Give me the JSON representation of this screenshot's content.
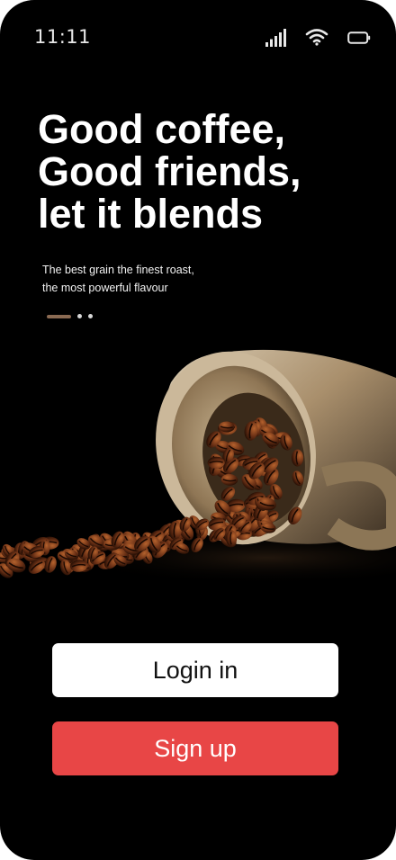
{
  "status_bar": {
    "time": "11:11",
    "icons": [
      "signal-icon",
      "wifi-icon",
      "battery-icon"
    ]
  },
  "hero": {
    "headline_lines": [
      "Good coffee,",
      "Good friends,",
      "let it blends"
    ],
    "tagline_lines": [
      "The best grain the finest roast,",
      "the most powerful flavour"
    ],
    "carousel": {
      "total_pages": 3,
      "active_page": 1
    },
    "image": "coffee-cup-with-spilled-beans"
  },
  "actions": {
    "login_label": "Login in",
    "signup_label": "Sign up"
  },
  "colors": {
    "background": "#000000",
    "accent_brown": "#8a6a52",
    "signup_red": "#e84646",
    "login_bg": "#ffffff"
  }
}
